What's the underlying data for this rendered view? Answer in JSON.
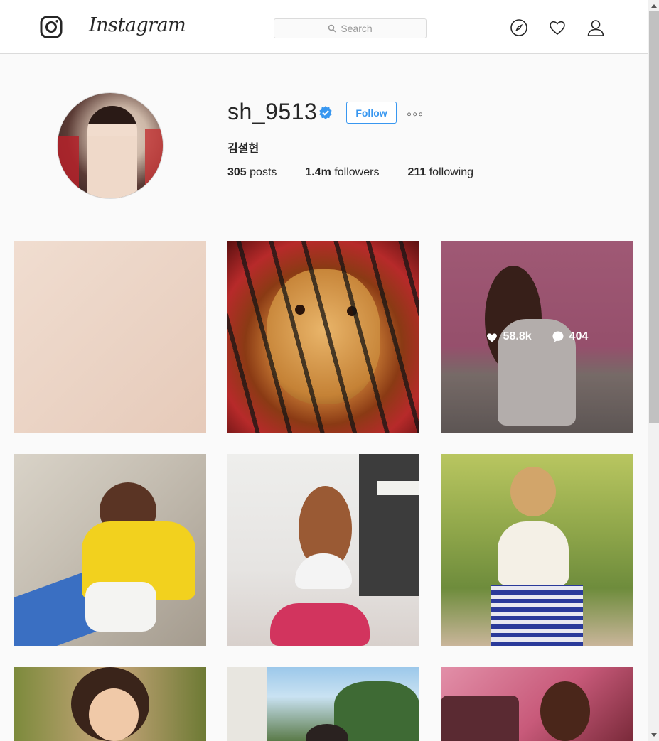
{
  "header": {
    "logo_text": "Instagram",
    "search_placeholder": "Search",
    "icons": [
      "instagram-glyph-icon",
      "search-icon",
      "compass-icon",
      "heart-icon",
      "user-icon"
    ]
  },
  "profile": {
    "username": "sh_9513",
    "verified": true,
    "follow_label": "Follow",
    "more_label": "◦◦◦",
    "full_name": "김설현",
    "stats": {
      "posts_count": "305",
      "posts_label": "posts",
      "followers_count": "1.4m",
      "followers_label": "followers",
      "following_count": "211",
      "following_label": "following"
    }
  },
  "posts": {
    "hover_overlay": {
      "likes": "58.8k",
      "comments": "404"
    }
  },
  "colors": {
    "accent": "#3897f0",
    "background": "#fafafa",
    "border": "#dbdbdb",
    "text": "#262626"
  }
}
